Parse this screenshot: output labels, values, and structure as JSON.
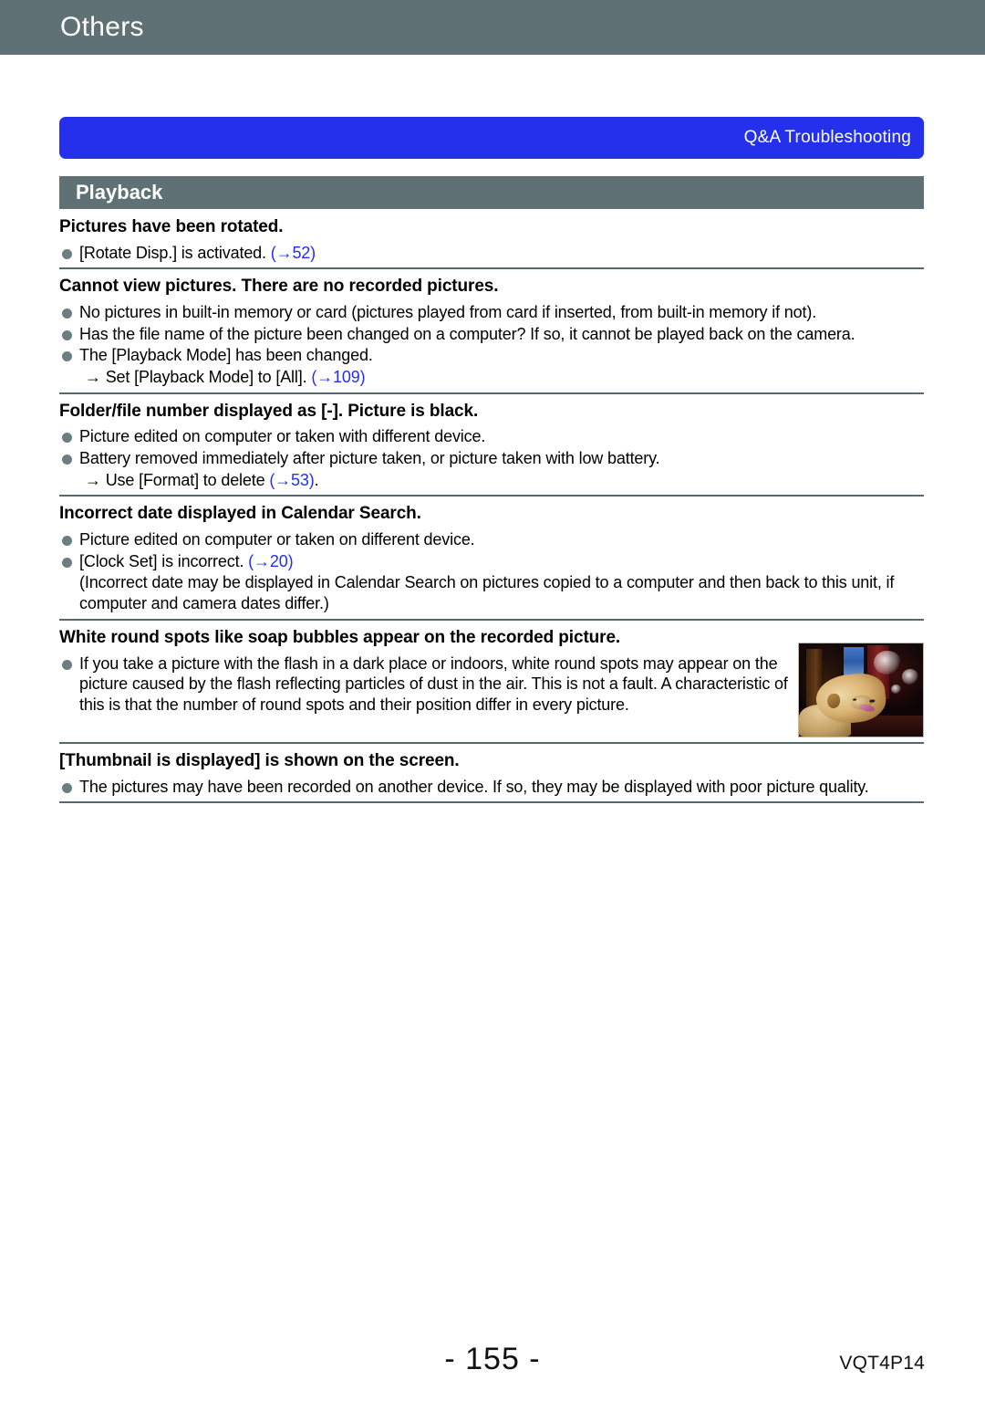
{
  "chapter": {
    "title": "Others"
  },
  "banner": {
    "label": "Q&A  Troubleshooting"
  },
  "section": {
    "label": "Playback"
  },
  "blocks": [
    {
      "question": "Pictures have been rotated.",
      "items": [
        {
          "type": "bullet",
          "text": "[Rotate Disp.] is activated. ",
          "ref": "(→52)"
        }
      ]
    },
    {
      "question": "Cannot view pictures. There are no recorded pictures.",
      "items": [
        {
          "type": "bullet",
          "text": "No pictures in built-in memory or card (pictures played from card if inserted, from built-in memory if not).",
          "ref": ""
        },
        {
          "type": "bullet",
          "text": "Has the file name of the picture been changed on a computer? If so, it cannot be played back on the camera.",
          "ref": ""
        },
        {
          "type": "bullet",
          "text": "The [Playback Mode] has been changed.",
          "ref": ""
        },
        {
          "type": "sub",
          "text": "→ Set [Playback Mode] to [All]. ",
          "ref": "(→109)"
        }
      ]
    },
    {
      "question": "Folder/file number displayed as [-]. Picture is black.",
      "items": [
        {
          "type": "bullet",
          "text": "Picture edited on computer or taken with different device.",
          "ref": ""
        },
        {
          "type": "bullet",
          "text": "Battery removed immediately after picture taken, or picture taken with low battery.",
          "ref": ""
        },
        {
          "type": "sub",
          "text": "→ Use [Format] to delete ",
          "ref": "(→53)",
          "ref_suffix": "."
        }
      ]
    },
    {
      "question": "Incorrect date displayed in Calendar Search.",
      "items": [
        {
          "type": "bullet",
          "text": "Picture edited on computer or taken on different device.",
          "ref": ""
        },
        {
          "type": "bullet",
          "text": "[Clock Set] is incorrect. ",
          "ref": "(→20)"
        },
        {
          "type": "note",
          "text": "(Incorrect date may be displayed in Calendar Search on pictures copied to a computer and then back to this unit, if computer and camera dates differ.)",
          "ref": ""
        }
      ]
    },
    {
      "question": "White round spots like soap bubbles appear on the recorded picture.",
      "has_photo": true,
      "photo_alt": "dog-with-orb-spots-photo",
      "items": [
        {
          "type": "bullet",
          "text": "If you take a picture with the flash in a dark place or indoors, white round spots may appear on the picture caused by the flash reflecting particles of dust in the air. This is not a fault. A characteristic of this is that the number of round spots and their position differ in every picture.",
          "ref": ""
        }
      ]
    },
    {
      "question": "[Thumbnail is displayed] is shown on the screen.",
      "items": [
        {
          "type": "bullet",
          "text": "The pictures may have been recorded on another device. If so, they may be displayed with poor picture quality.",
          "ref": ""
        }
      ]
    }
  ],
  "footer": {
    "page_number": "- 155 -",
    "doc_code": "VQT4P14"
  },
  "colors": {
    "chapter_bar": "#5f7174",
    "banner": "#2430ec",
    "section_bar": "#5f7174",
    "bullet": "#6b7f82",
    "reference_link": "#2430ec",
    "rule": "#55686c"
  }
}
